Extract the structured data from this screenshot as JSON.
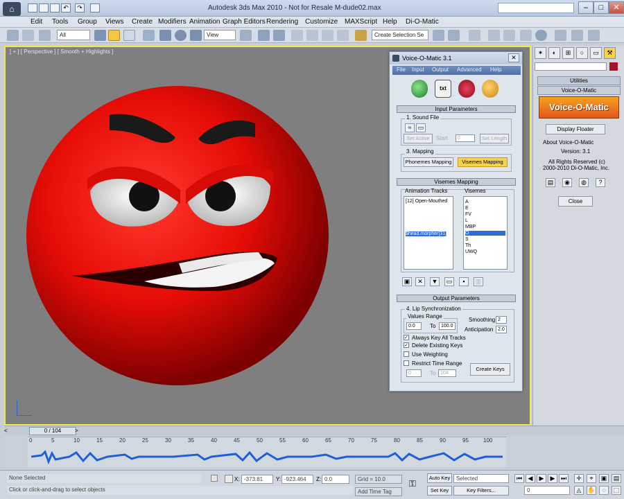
{
  "window": {
    "title": "Autodesk 3ds Max 2010    -  Not for Resale      M-dude02.max",
    "search_placeholder": ""
  },
  "menubar": [
    "Edit",
    "Tools",
    "Group",
    "Views",
    "Create",
    "Modifiers",
    "Animation",
    "Graph Editors",
    "Rendering",
    "Customize",
    "MAXScript",
    "Help",
    "Di-O-Matic"
  ],
  "toolbar": {
    "filter": "All",
    "coord": "View",
    "selection_set": "Create Selection Se"
  },
  "viewport": {
    "label": "[ + ] [ Perspective ] [ Smooth + Highlights ]"
  },
  "dialog": {
    "title": "Voice-O-Matic 3.1",
    "menu": [
      "File",
      "Input",
      "Output",
      "Advanced",
      "Help"
    ],
    "input_parameters": "Input Parameters",
    "sound_file_label": "1. Sound File",
    "set_active": "Set Active",
    "start_label": "Start",
    "start_value": "0",
    "set_length": "Set Length",
    "mapping_label": "3. Mapping",
    "phonemes_btn": "Phonemes Mapping",
    "visemes_btn": "Visemes Mapping",
    "visemes_mapping": "Visemes Mapping",
    "animation_tracks_label": "Animation Tracks",
    "visemes_label": "Visemes",
    "tracks": [
      "[12] Open-Mouthed",
      "$head.morpher[31]"
    ],
    "visemes": [
      "A",
      "E",
      "FV",
      "L",
      "MBP",
      "O",
      "S",
      "Th",
      "UWQ"
    ],
    "selected_viseme": "O",
    "output_parameters": "Output Parameters",
    "lip_sync_label": "4. Lip Synchronization",
    "values_range_label": "Values Range",
    "range_from": "0.0",
    "to_label": "To",
    "range_to": "100.0",
    "smoothing_label": "Smoothing",
    "smoothing_value": "2",
    "anticipation_label": "Anticipation",
    "anticipation_value": "2.0",
    "always_key": "Always Key All Tracks",
    "delete_keys": "Delete Existing Keys",
    "use_weighting": "Use Weighting",
    "restrict_time": "Restrict Time Range",
    "restrict_from": "0",
    "restrict_to": "104",
    "create_keys": "Create Keys",
    "always_key_checked": true,
    "delete_keys_checked": true
  },
  "cmdpanel": {
    "utilities": "Utilities",
    "plugin": "Voice-O-Matic",
    "logo_text": "Voice-O-Matic",
    "display_floater": "Display Floater",
    "about": "About Voice-O-Matic",
    "version": "Version: 3.1",
    "rights1": "All Rights Reserved (c)",
    "rights2": "2000-2010 Di-O-Matic, Inc.",
    "close": "Close"
  },
  "timeline": {
    "frame": "0 / 104",
    "ticks": [
      "0",
      "5",
      "10",
      "15",
      "20",
      "25",
      "30",
      "35",
      "40",
      "45",
      "50",
      "55",
      "60",
      "65",
      "70",
      "75",
      "80",
      "85",
      "90",
      "95",
      "100"
    ]
  },
  "status": {
    "selected": "None Selected",
    "prompt": "Click or click-and-drag to select objects",
    "x_label": "X:",
    "x": "-373.81",
    "y_label": "Y:",
    "y": "-923.464",
    "z_label": "Z:",
    "z": "0.0",
    "grid": "Grid = 10.0",
    "add_time_tag": "Add Time Tag",
    "auto_key": "Auto Key",
    "set_key": "Set Key",
    "selected_mode": "Selected",
    "key_filters": "Key Filters...",
    "frame_field": "0"
  }
}
